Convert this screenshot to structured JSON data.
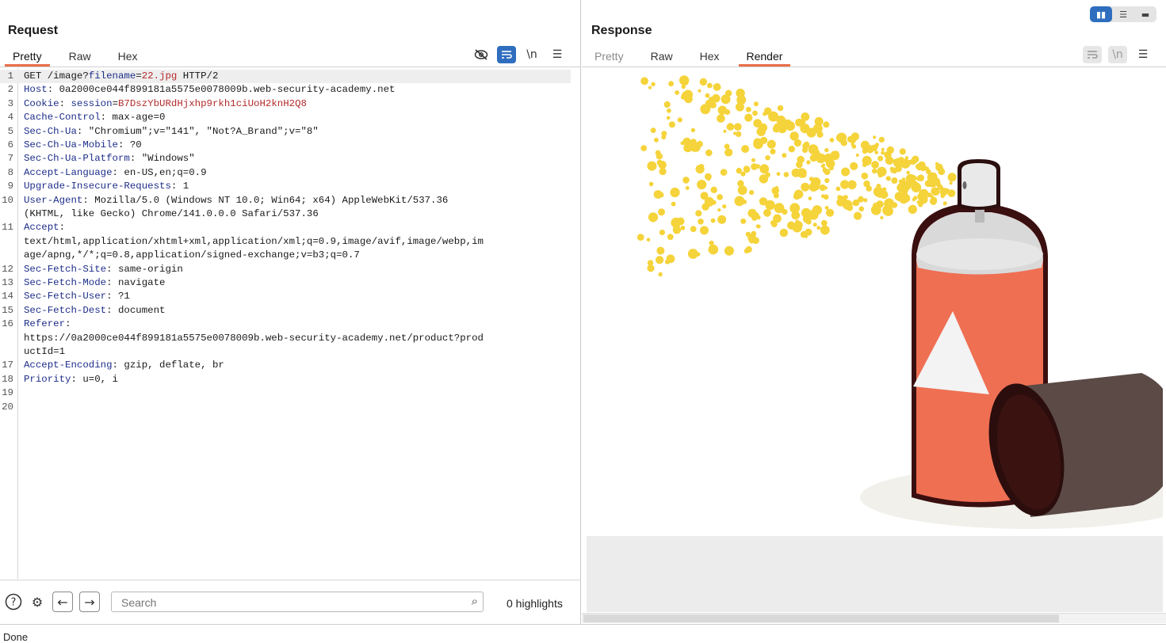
{
  "request": {
    "title": "Request",
    "tabs": [
      {
        "label": "Pretty",
        "active": true
      },
      {
        "label": "Raw",
        "active": false
      },
      {
        "label": "Hex",
        "active": false
      }
    ],
    "tools": {
      "hide_icon": "eye-slash-icon",
      "wrap_icon": "word-wrap-icon",
      "newline_label": "\\n",
      "menu_icon": "hamburger-menu-icon"
    },
    "lines": [
      {
        "n": "1",
        "parts": [
          [
            "",
            "GET /image?"
          ],
          [
            "hk",
            "filename"
          ],
          [
            "",
            "="
          ],
          [
            "rk",
            "22.jpg"
          ],
          [
            "",
            " HTTP/2"
          ]
        ]
      },
      {
        "n": "2",
        "parts": [
          [
            "hk",
            "Host"
          ],
          [
            "",
            ": 0a2000ce044f899181a5575e0078009b.web-security-academy.net"
          ]
        ]
      },
      {
        "n": "3",
        "parts": [
          [
            "hk",
            "Cookie"
          ],
          [
            "",
            ": "
          ],
          [
            "hk",
            "session"
          ],
          [
            "",
            "="
          ],
          [
            "rk",
            "B7DszYbURdHjxhp9rkh1ciUoH2knH2Q8"
          ]
        ]
      },
      {
        "n": "4",
        "parts": [
          [
            "hk",
            "Cache-Control"
          ],
          [
            "",
            ": max-age=0"
          ]
        ]
      },
      {
        "n": "5",
        "parts": [
          [
            "hk",
            "Sec-Ch-Ua"
          ],
          [
            "",
            ": \"Chromium\";v=\"141\", \"Not?A_Brand\";v=\"8\""
          ]
        ]
      },
      {
        "n": "6",
        "parts": [
          [
            "hk",
            "Sec-Ch-Ua-Mobile"
          ],
          [
            "",
            ": ?0"
          ]
        ]
      },
      {
        "n": "7",
        "parts": [
          [
            "hk",
            "Sec-Ch-Ua-Platform"
          ],
          [
            "",
            ": \"Windows\""
          ]
        ]
      },
      {
        "n": "8",
        "parts": [
          [
            "hk",
            "Accept-Language"
          ],
          [
            "",
            ": en-US,en;q=0.9"
          ]
        ]
      },
      {
        "n": "9",
        "parts": [
          [
            "hk",
            "Upgrade-Insecure-Requests"
          ],
          [
            "",
            ": 1"
          ]
        ]
      },
      {
        "n": "10",
        "parts": [
          [
            "hk",
            "User-Agent"
          ],
          [
            "",
            ": Mozilla/5.0 (Windows NT 10.0; Win64; x64) AppleWebKit/537.36"
          ]
        ]
      },
      {
        "n": "",
        "parts": [
          [
            "",
            "(KHTML, like Gecko) Chrome/141.0.0.0 Safari/537.36"
          ]
        ]
      },
      {
        "n": "11",
        "parts": [
          [
            "hk",
            "Accept"
          ],
          [
            "",
            ":"
          ]
        ]
      },
      {
        "n": "",
        "parts": [
          [
            "",
            "text/html,application/xhtml+xml,application/xml;q=0.9,image/avif,image/webp,im"
          ]
        ]
      },
      {
        "n": "",
        "parts": [
          [
            "",
            "age/apng,*/*;q=0.8,application/signed-exchange;v=b3;q=0.7"
          ]
        ]
      },
      {
        "n": "12",
        "parts": [
          [
            "hk",
            "Sec-Fetch-Site"
          ],
          [
            "",
            ": same-origin"
          ]
        ]
      },
      {
        "n": "13",
        "parts": [
          [
            "hk",
            "Sec-Fetch-Mode"
          ],
          [
            "",
            ": navigate"
          ]
        ]
      },
      {
        "n": "14",
        "parts": [
          [
            "hk",
            "Sec-Fetch-User"
          ],
          [
            "",
            ": ?1"
          ]
        ]
      },
      {
        "n": "15",
        "parts": [
          [
            "hk",
            "Sec-Fetch-Dest"
          ],
          [
            "",
            ": document"
          ]
        ]
      },
      {
        "n": "16",
        "parts": [
          [
            "hk",
            "Referer"
          ],
          [
            "",
            ":"
          ]
        ]
      },
      {
        "n": "",
        "parts": [
          [
            "",
            "https://0a2000ce044f899181a5575e0078009b.web-security-academy.net/product?prod"
          ]
        ]
      },
      {
        "n": "",
        "parts": [
          [
            "",
            "uctId=1"
          ]
        ]
      },
      {
        "n": "17",
        "parts": [
          [
            "hk",
            "Accept-Encoding"
          ],
          [
            "",
            ": gzip, deflate, br"
          ]
        ]
      },
      {
        "n": "18",
        "parts": [
          [
            "hk",
            "Priority"
          ],
          [
            "",
            ": u=0, i"
          ]
        ]
      },
      {
        "n": "19",
        "parts": []
      },
      {
        "n": "20",
        "parts": []
      }
    ],
    "search": {
      "placeholder": "Search",
      "value": "",
      "highlights": "0 highlights"
    }
  },
  "response": {
    "title": "Response",
    "tabs": [
      {
        "label": "Pretty",
        "active": false,
        "disabled": true
      },
      {
        "label": "Raw",
        "active": false
      },
      {
        "label": "Hex",
        "active": false
      },
      {
        "label": "Render",
        "active": true
      }
    ],
    "tools": {
      "wrap_icon": "word-wrap-icon",
      "newline_label": "\\n",
      "menu_icon": "hamburger-menu-icon"
    },
    "rendered_image": "spray-paint-can-icon"
  },
  "layout_toggle": {
    "icons": [
      "side-by-side-icon",
      "stacked-icon",
      "single-pane-icon"
    ],
    "active": 0
  },
  "status": {
    "text": "Done"
  },
  "colors": {
    "accent": "#2f6ebf",
    "tab_underline": "#e8704a",
    "header_key": "#1e2e8a",
    "param_value": "#b42b2b",
    "spray_yellow": "#f5d33a",
    "can_orange": "#ef6f53",
    "cap_dark": "#5b4a46"
  }
}
